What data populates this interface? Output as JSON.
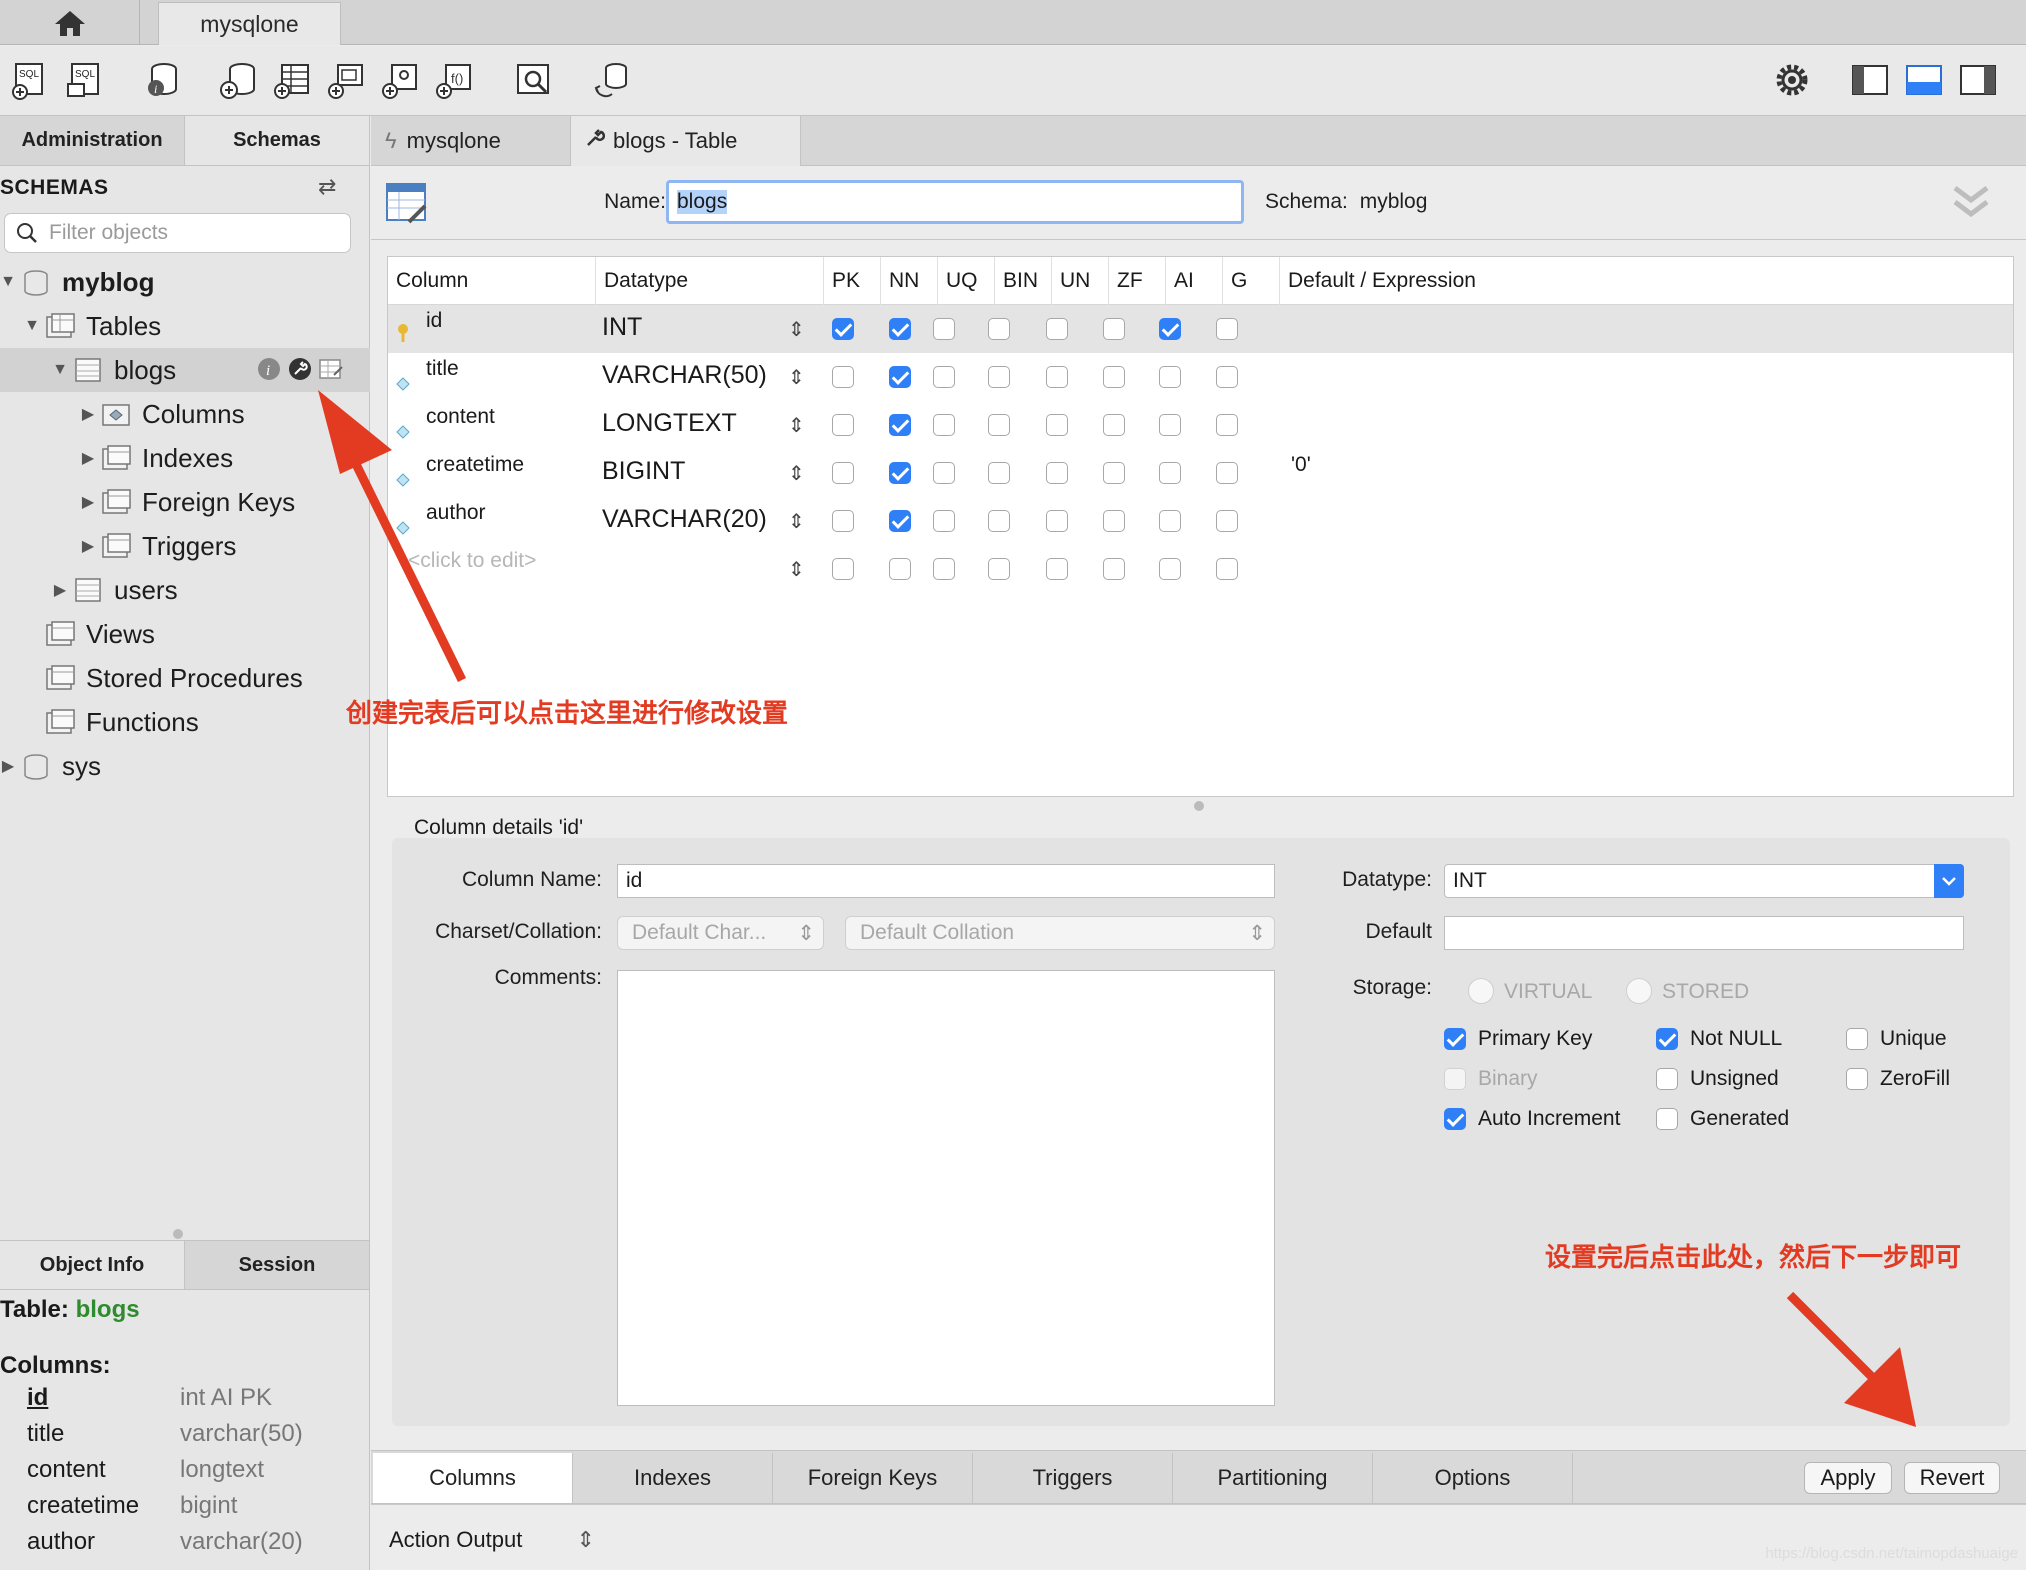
{
  "tab_strip": {
    "connection_tab": "mysqlone"
  },
  "toolbar": {
    "icons": [
      "new-sql-tab-icon",
      "open-sql-script-icon",
      "schema-inspector-icon",
      "create-schema-icon",
      "create-table-icon",
      "create-view-icon",
      "create-procedure-icon",
      "create-function-icon",
      "search-table-data-icon",
      "reconnect-icon",
      "settings-gear-icon",
      "toggle-sidebar-icon",
      "toggle-output-icon",
      "toggle-secondary-sidebar-icon"
    ]
  },
  "left_panel": {
    "tabs": [
      "Administration",
      "Schemas"
    ],
    "active_tab": "Schemas",
    "header": "SCHEMAS",
    "filter_placeholder": "Filter objects",
    "tree": {
      "schema1": "myblog",
      "tables": "Tables",
      "table_blogs": "blogs",
      "columns": "Columns",
      "indexes": "Indexes",
      "foreign_keys": "Foreign Keys",
      "triggers": "Triggers",
      "table_users": "users",
      "views": "Views",
      "stored_procedures": "Stored Procedures",
      "functions": "Functions",
      "schema2": "sys"
    },
    "info_tabs": [
      "Object Info",
      "Session"
    ],
    "object_info": {
      "table_label": "Table:",
      "table_name": "blogs",
      "columns_label": "Columns:",
      "columns": [
        {
          "name": "id",
          "type": "int AI PK"
        },
        {
          "name": "title",
          "type": "varchar(50)"
        },
        {
          "name": "content",
          "type": "longtext"
        },
        {
          "name": "createtime",
          "type": "bigint"
        },
        {
          "name": "author",
          "type": "varchar(20)"
        }
      ]
    }
  },
  "editor_tabs": [
    {
      "label": "mysqlone",
      "icon": "sql-bolt-icon"
    },
    {
      "label": "blogs - Table",
      "icon": "wrench-icon"
    }
  ],
  "table_header": {
    "name_label": "Name:",
    "name_value": "blogs",
    "schema_label": "Schema:",
    "schema_value": "myblog"
  },
  "grid": {
    "headers": [
      "Column",
      "Datatype",
      "PK",
      "NN",
      "UQ",
      "BIN",
      "UN",
      "ZF",
      "AI",
      "G",
      "Default / Expression"
    ],
    "rows": [
      {
        "column": "id",
        "datatype": "INT",
        "flags": [
          true,
          true,
          false,
          false,
          false,
          false,
          true,
          false
        ],
        "default": ""
      },
      {
        "column": "title",
        "datatype": "VARCHAR(50)",
        "flags": [
          false,
          true,
          false,
          false,
          false,
          false,
          false,
          false
        ],
        "default": ""
      },
      {
        "column": "content",
        "datatype": "LONGTEXT",
        "flags": [
          false,
          true,
          false,
          false,
          false,
          false,
          false,
          false
        ],
        "default": ""
      },
      {
        "column": "createtime",
        "datatype": "BIGINT",
        "flags": [
          false,
          true,
          false,
          false,
          false,
          false,
          false,
          false
        ],
        "default": "'0'"
      },
      {
        "column": "author",
        "datatype": "VARCHAR(20)",
        "flags": [
          false,
          true,
          false,
          false,
          false,
          false,
          false,
          false
        ],
        "default": ""
      },
      {
        "column": "<click to edit>",
        "datatype": "",
        "flags": [
          false,
          false,
          false,
          false,
          false,
          false,
          false,
          false
        ],
        "default": ""
      }
    ]
  },
  "details": {
    "title": "Column details 'id'",
    "column_name_label": "Column Name:",
    "column_name_value": "id",
    "charset_label": "Charset/Collation:",
    "charset_value": "Default Char...",
    "collation_value": "Default Collation",
    "comments_label": "Comments:",
    "datatype_label": "Datatype:",
    "datatype_value": "INT",
    "default_label": "Default",
    "storage_label": "Storage:",
    "storage_options": [
      "VIRTUAL",
      "STORED"
    ],
    "checks": {
      "primary_key": {
        "label": "Primary Key",
        "checked": true
      },
      "not_null": {
        "label": "Not NULL",
        "checked": true
      },
      "unique": {
        "label": "Unique",
        "checked": false
      },
      "binary": {
        "label": "Binary",
        "checked": false
      },
      "unsigned": {
        "label": "Unsigned",
        "checked": false
      },
      "zerofill": {
        "label": "ZeroFill",
        "checked": false
      },
      "auto_increment": {
        "label": "Auto Increment",
        "checked": true
      },
      "generated": {
        "label": "Generated",
        "checked": false
      }
    }
  },
  "bottom_tabs": [
    "Columns",
    "Indexes",
    "Foreign Keys",
    "Triggers",
    "Partitioning",
    "Options"
  ],
  "buttons": {
    "apply": "Apply",
    "revert": "Revert"
  },
  "action_output": "Action Output",
  "annotations": {
    "left": "创建完表后可以点击这里进行修改设置",
    "right": "设置完后点击此处，然后下一步即可"
  },
  "watermark": "https://blog.csdn.net/taimopdashuaige",
  "colors": {
    "accent": "#2f7ff6",
    "annotation": "#e33a22",
    "object_info_name": "#2e8b2e"
  }
}
